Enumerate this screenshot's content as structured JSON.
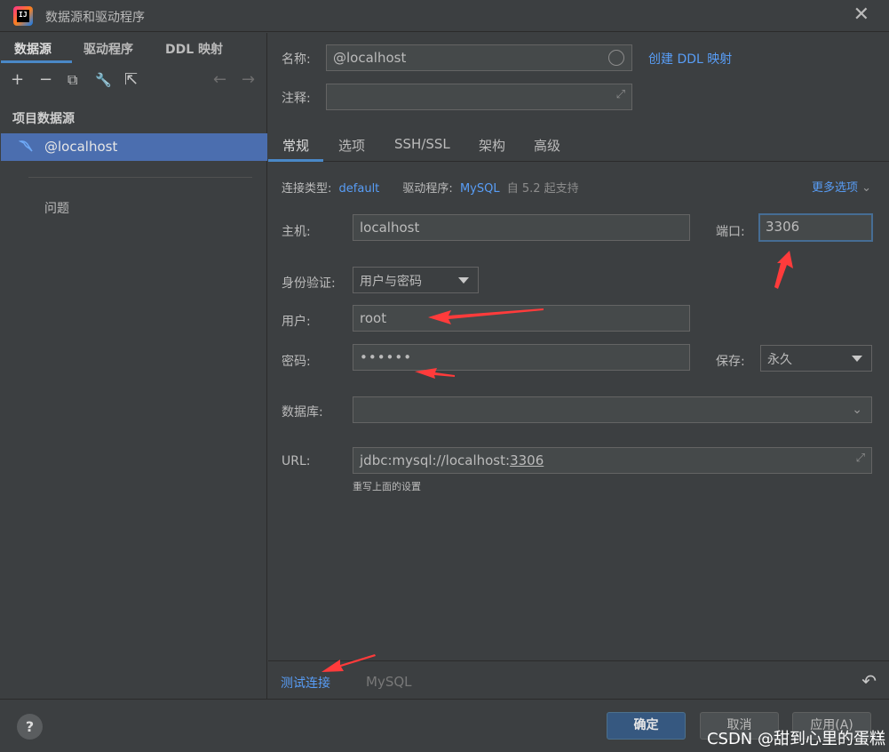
{
  "window": {
    "title": "数据源和驱动程序",
    "app_icon_text": "IJ"
  },
  "left": {
    "tabs": [
      "数据源",
      "驱动程序",
      "DDL 映射"
    ],
    "tools": {
      "add": "+",
      "remove": "−",
      "duplicate": "⧉",
      "settings": "🔧",
      "export": "⇱",
      "back": "←",
      "forward": "→"
    },
    "section_label": "项目数据源",
    "datasource": "@localhost",
    "problems": "问题"
  },
  "form": {
    "name_label": "名称:",
    "name_value": "@localhost",
    "create_ddl_link": "创建 DDL 映射",
    "comment_label": "注释:",
    "comment_value": "",
    "tabs": [
      "常规",
      "选项",
      "SSH/SSL",
      "架构",
      "高级"
    ],
    "conn_type_label": "连接类型:",
    "conn_type_value": "default",
    "driver_label": "驱动程序:",
    "driver_value": "MySQL",
    "driver_note": "自 5.2 起支持",
    "more_options": "更多选项",
    "host_label": "主机:",
    "host_value": "localhost",
    "port_label": "端口:",
    "port_value": "3306",
    "auth_label": "身份验证:",
    "auth_value": "用户与密码",
    "user_label": "用户:",
    "user_value": "root",
    "password_label": "密码:",
    "password_value": "••••••",
    "save_label": "保存:",
    "save_value": "永久",
    "database_label": "数据库:",
    "database_value": "",
    "url_label": "URL:",
    "url_prefix": "jdbc:mysql://localhost:",
    "url_port": "3306",
    "url_hint": "重写上面的设置",
    "test_connection": "测试连接",
    "driver_name_dim": "MySQL"
  },
  "footer": {
    "help": "?",
    "ok": "确定",
    "cancel": "取消",
    "apply": "应用(A)",
    "watermark": "CSDN @甜到心里的蛋糕"
  },
  "colors": {
    "accent": "#4a88c7",
    "link": "#589df6",
    "selection": "#4b6eaf",
    "annotation_arrow": "#ff3b3b"
  }
}
